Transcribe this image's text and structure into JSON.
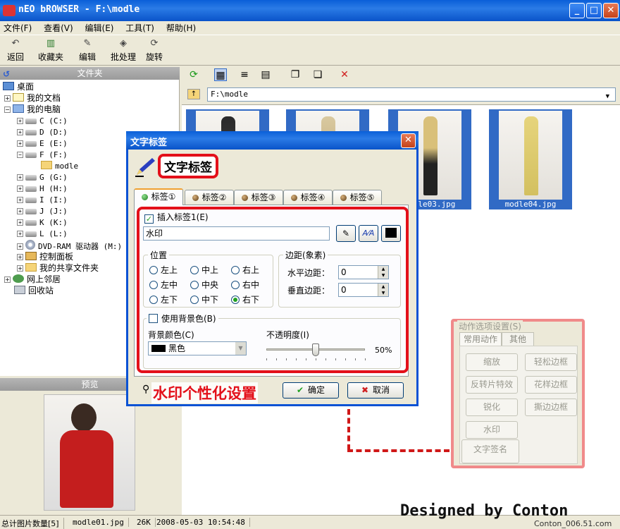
{
  "window": {
    "title": "nEO bROWSER - F:\\modle"
  },
  "menu": [
    "文件(F)",
    "查看(V)",
    "编辑(E)",
    "工具(T)",
    "帮助(H)"
  ],
  "toolbar": {
    "back": "返回",
    "favorites": "收藏夹",
    "edit": "编辑",
    "batch": "批处理",
    "rotate": "旋转"
  },
  "left_panel": {
    "header": "文件夹",
    "tree": {
      "desktop": "桌面",
      "my_docs": "我的文档",
      "my_computer": "我的电脑",
      "drive_c": "C (C:)",
      "drive_d": "D (D:)",
      "drive_e": "E (E:)",
      "drive_f": "F (F:)",
      "folder_modle": "modle",
      "drive_g": "G (G:)",
      "drive_h": "H (H:)",
      "drive_i": "I (I:)",
      "drive_j": "J (J:)",
      "drive_k": "K (K:)",
      "drive_l": "L (L:)",
      "dvd": "DVD-RAM 驱动器 (M:)",
      "control_panel": "控制面板",
      "shared": "我的共享文件夹",
      "network": "网上邻居",
      "recycle": "回收站"
    },
    "preview_header": "预览"
  },
  "address": {
    "path": "F:\\modle"
  },
  "thumbnails": [
    {
      "name": ""
    },
    {
      "name": ""
    },
    {
      "name": "modle03.jpg"
    },
    {
      "name": "modle04.jpg"
    }
  ],
  "status": {
    "total": "总计图片数量[5]",
    "file": "modle01.jpg",
    "size": "26K",
    "date": "2008-05-03 10:54:48"
  },
  "watermark": "Designed by Conton",
  "site": "Conton_006.51.com",
  "dialog": {
    "title": "文字标签",
    "heading": "文字标签",
    "tabs": [
      "标签①",
      "标签②",
      "标签③",
      "标签④",
      "标签⑤"
    ],
    "insert_label": "插入标签1(E)",
    "insert_checked": true,
    "text_value": "水印",
    "position_group": "位置",
    "positions": [
      "左上",
      "中上",
      "右上",
      "左中",
      "中央",
      "右中",
      "左下",
      "中下",
      "右下"
    ],
    "selected_position": "右下",
    "margin_group": "边距(象素)",
    "h_margin_label": "水平边距：",
    "h_margin_value": "0",
    "v_margin_label": "垂直边距：",
    "v_margin_value": "0",
    "use_bg_label": "使用背景色(B)",
    "bg_color_label": "背景颜色(C)",
    "bg_color_value": "黑色",
    "opacity_label": "不透明度(I)",
    "opacity_percent": 50,
    "opacity_text": "50%",
    "ok": "确定",
    "cancel": "取消",
    "callout": "水印个性化设置"
  },
  "action_panel": {
    "title": "动作选项设置(S)",
    "tabs": [
      "常用动作",
      "其他"
    ],
    "buttons": [
      "缩放",
      "轻松边框",
      "反转片特效",
      "花样边框",
      "锐化",
      "撕边边框",
      "水印",
      "文字签名"
    ]
  },
  "colors": {
    "titlebar": "#0a5fd8",
    "selection": "#316ac5",
    "highlight": "#e3101a"
  }
}
